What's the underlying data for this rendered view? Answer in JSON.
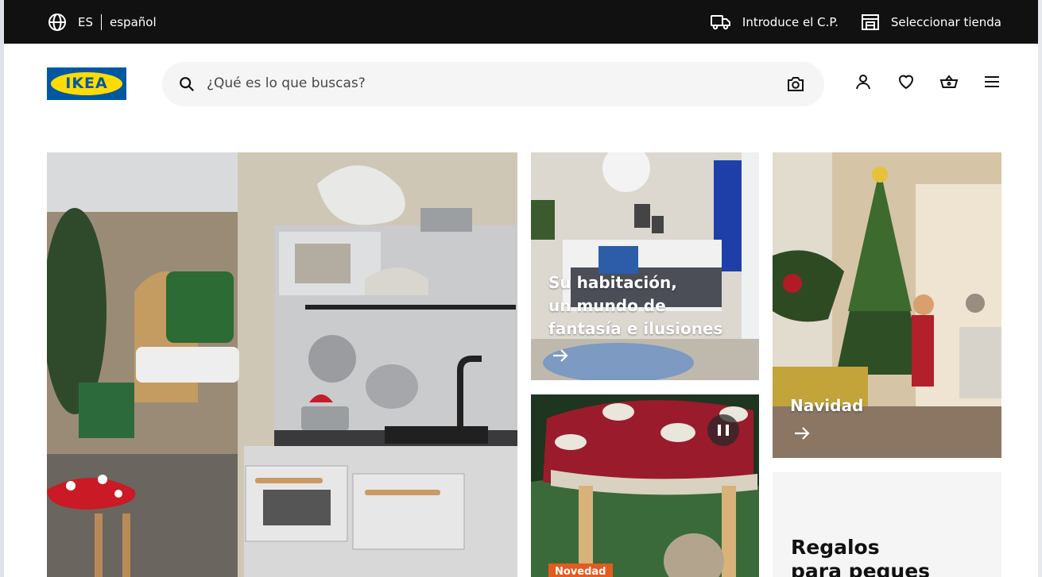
{
  "topbar": {
    "lang_code": "ES",
    "lang_name": "español",
    "postcode": "Introduce el C.P.",
    "store": "Seleccionar tienda"
  },
  "header": {
    "logo_text": "IKEA",
    "search_placeholder": "¿Qué es lo que buscas?"
  },
  "tiles": {
    "bedroom_caption": "Su habitación, un mundo de fantasía e ilusiones",
    "bedroom_lines": [
      "Su habitación,",
      "un mundo de",
      "fantasía e ilusiones"
    ],
    "christmas_caption": "Navidad",
    "new_badge": "Novedad",
    "gifts_lines": [
      "Regalos",
      "para peques"
    ]
  },
  "colors": {
    "topbar": "#111111",
    "brand_blue": "#0058a3",
    "brand_yellow": "#ffdb00",
    "badge": "#e35b1e"
  },
  "icons": [
    "globe-icon",
    "truck-icon",
    "store-icon",
    "search-icon",
    "camera-icon",
    "user-icon",
    "heart-icon",
    "basket-icon",
    "menu-icon",
    "arrow-right-icon",
    "pause-icon"
  ]
}
